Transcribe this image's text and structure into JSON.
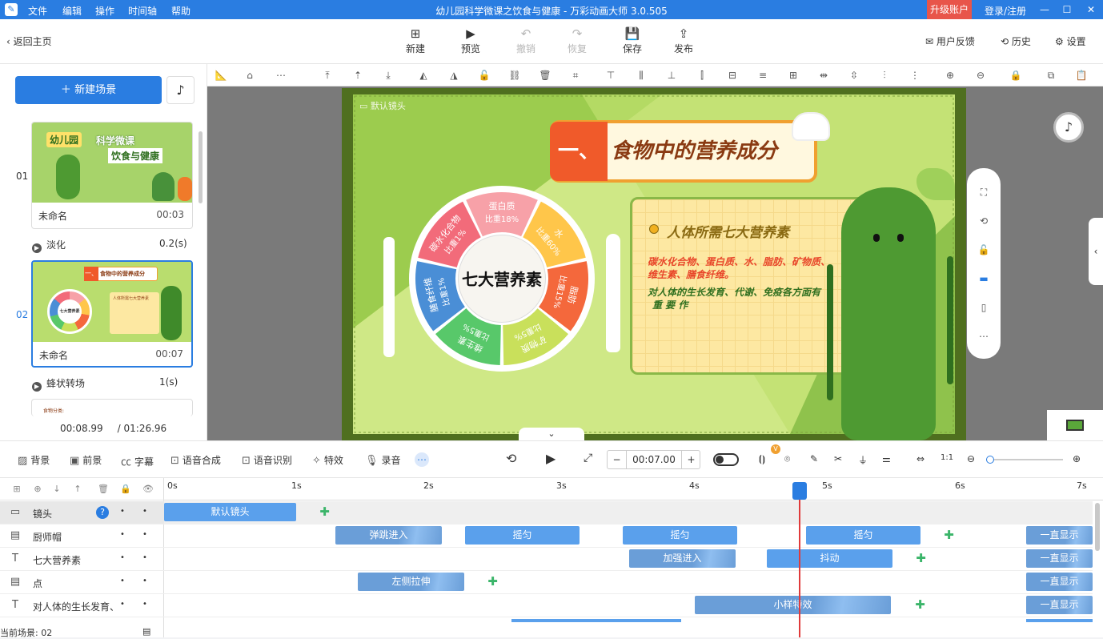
{
  "titlebar": {
    "menus": [
      "文件",
      "编辑",
      "操作",
      "时间轴",
      "帮助"
    ],
    "title": "幼儿园科学微课之饮食与健康 - 万彩动画大师 3.0.505",
    "upgrade": "升级账户",
    "login": "登录/注册"
  },
  "toolbar": {
    "back": "返回主页",
    "new": "新建",
    "preview": "预览",
    "undo": "撤销",
    "redo": "恢复",
    "save": "保存",
    "publish": "发布",
    "feedback": "用户反馈",
    "history": "历史",
    "settings": "设置"
  },
  "leftpanel": {
    "new_scene": "新建场景",
    "scenes": [
      {
        "num": "01",
        "name": "未命名",
        "duration": "00:03",
        "transition": "淡化",
        "trans_value": "0.2(s)",
        "thumb_texts": [
          "幼儿园",
          "科学微课",
          "饮食与健康"
        ]
      },
      {
        "num": "02",
        "name": "未命名",
        "duration": "00:07",
        "transition": "蜂状转场",
        "trans_value": "1(s)",
        "thumb_texts": [
          "一、",
          "食物中的营养成分",
          "七大营养素",
          "人体所需七大营养素"
        ]
      }
    ],
    "third_thumb_text": "食物分类:",
    "time_current": "00:08.99",
    "time_total": "/ 01:26.96"
  },
  "stage": {
    "camera_label": "默认镜头",
    "heading_prefix": "一、",
    "heading": "食物中的营养成分",
    "plate_center": "七大营养素",
    "segments": [
      {
        "name": "碳水化合物",
        "ratio": "比重1%",
        "color": "#f26b7a"
      },
      {
        "name": "蛋白质",
        "ratio": "比重18%",
        "color": "#f7a1a8"
      },
      {
        "name": "水",
        "ratio": "比重60%",
        "color": "#ffc64a"
      },
      {
        "name": "脂肪",
        "ratio": "比重15%",
        "color": "#f4683c"
      },
      {
        "name": "矿物质",
        "ratio": "比重5%",
        "color": "#c9e05b"
      },
      {
        "name": "维生素",
        "ratio": "比重5%",
        "color": "#58c86a"
      },
      {
        "name": "膳食纤维",
        "ratio": "比重1%",
        "color": "#4a8ed6"
      }
    ],
    "card_title": "人体所需七大营养素",
    "card_line1": "碳水化合物、蛋白质、水、脂肪、矿物质、",
    "card_line2": "维生素、膳食纤维。",
    "card_line3": "对人体的生长发育、代谢、免疫各方面有",
    "card_line4": "重 要 作"
  },
  "timeline_toolbar": {
    "background": "背景",
    "foreground": "前景",
    "subtitle": "字幕",
    "tts": "语音合成",
    "asr": "语音识别",
    "effects": "特效",
    "record": "录音",
    "timecode": "00:07.00",
    "badge": "V"
  },
  "timeline": {
    "ticks": [
      "0s",
      "1s",
      "2s",
      "3s",
      "4s",
      "5s",
      "6s",
      "7s"
    ],
    "tracks": [
      {
        "name": "镜头",
        "icon": "camera-icon",
        "help": "?",
        "clips": [
          {
            "label": "默认镜头"
          }
        ]
      },
      {
        "name": "厨师帽",
        "icon": "image-icon",
        "clips": [
          {
            "label": "弹跳进入"
          },
          {
            "label": "摇匀"
          },
          {
            "label": "摇匀"
          },
          {
            "label": "摇匀"
          },
          {
            "label": "一直显示"
          }
        ]
      },
      {
        "name": "七大营养素",
        "icon": "text-icon",
        "clips": [
          {
            "label": "加强进入"
          },
          {
            "label": "抖动"
          },
          {
            "label": "一直显示"
          }
        ]
      },
      {
        "name": "点",
        "icon": "image-icon",
        "clips": [
          {
            "label": "左侧拉伸"
          },
          {
            "label": "一直显示"
          }
        ]
      },
      {
        "name": "对人体的生长发育、",
        "icon": "text-icon",
        "clips": [
          {
            "label": "小样特效"
          },
          {
            "label": "一直显示"
          }
        ]
      }
    ],
    "dot": "•",
    "status": "当前场景: 02"
  }
}
